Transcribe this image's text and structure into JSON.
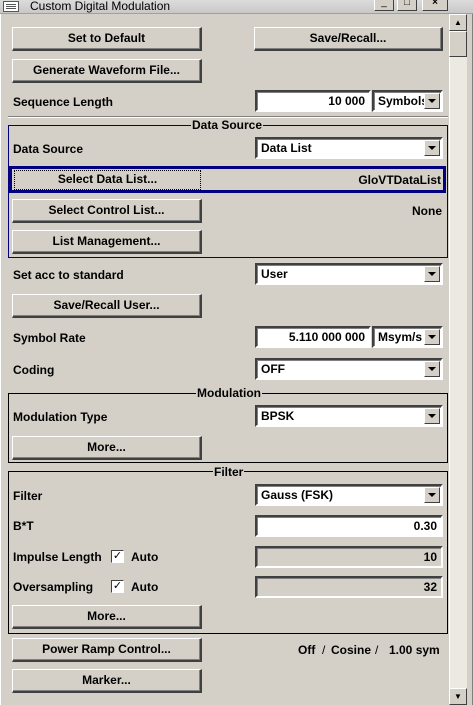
{
  "window": {
    "title": "Custom Digital Modulation",
    "controls": {
      "minimize": "_",
      "maximize": "□",
      "close": "×"
    }
  },
  "top_buttons": {
    "set_to_default": "Set to Default",
    "save_recall": "Save/Recall...",
    "generate_waveform": "Generate Waveform File..."
  },
  "sequence_length": {
    "label": "Sequence Length",
    "value": "10 000",
    "unit": "Symbols"
  },
  "data_source_group": {
    "legend": "Data Source",
    "data_source_label": "Data Source",
    "data_source_value": "Data List",
    "select_data_list": "Select Data List...",
    "data_list_name": "GloVTDataList",
    "select_control_list": "Select Control List...",
    "control_list_name": "None",
    "list_management": "List Management..."
  },
  "standard": {
    "label": "Set acc to standard",
    "value": "User",
    "save_recall_user": "Save/Recall User..."
  },
  "symbol_rate": {
    "label": "Symbol Rate",
    "value": "5.110 000 000",
    "unit": "Msym/s"
  },
  "coding": {
    "label": "Coding",
    "value": "OFF"
  },
  "modulation_group": {
    "legend": "Modulation",
    "type_label": "Modulation Type",
    "type_value": "BPSK",
    "more": "More..."
  },
  "filter_group": {
    "legend": "Filter",
    "filter_label": "Filter",
    "filter_value": "Gauss (FSK)",
    "bt_label": "B*T",
    "bt_value": "0.30",
    "impulse_label": "Impulse Length",
    "impulse_auto": "Auto",
    "impulse_checked": "✓",
    "impulse_value": "10",
    "oversampling_label": "Oversampling",
    "oversampling_auto": "Auto",
    "oversampling_checked": "✓",
    "oversampling_value": "32",
    "more": "More..."
  },
  "power_ramp": {
    "button": "Power Ramp Control...",
    "state": "Off",
    "sep1": "/",
    "shape": "Cosine",
    "sep2": "/",
    "time": "1.00 sym"
  },
  "marker": {
    "button": "Marker..."
  },
  "scrollbar": {
    "up": "▲",
    "down": "▼"
  }
}
